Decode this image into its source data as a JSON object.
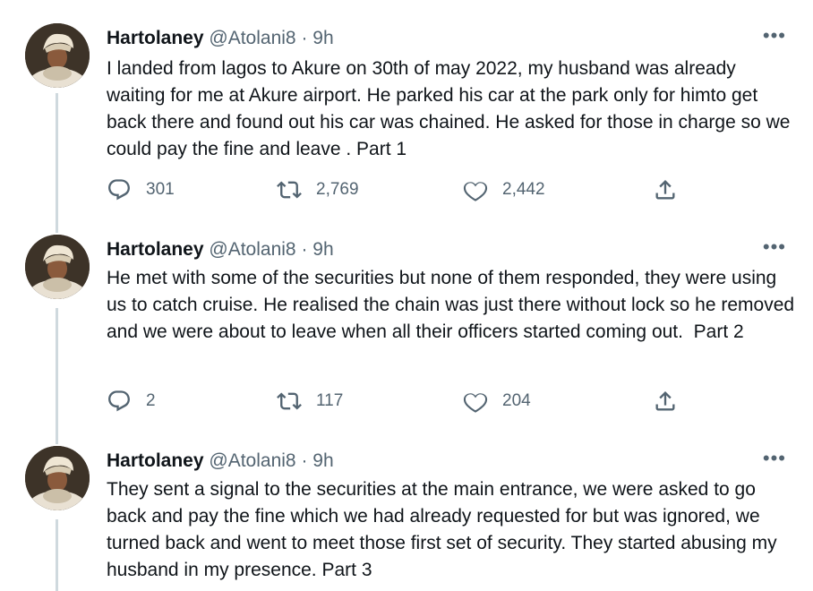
{
  "tweets": [
    {
      "name": "Hartolaney",
      "handle": "@Atolani8",
      "separator": "·",
      "time": "9h",
      "text": "I landed from lagos to Akure on 30th of may 2022, my husband was already waiting for me at Akure airport. He parked his car at the park only for himto get back there and found out his car was chained. He asked for those in charge so we could pay the fine and leave . Part 1",
      "replies": "301",
      "retweets": "2,769",
      "likes": "2,442"
    },
    {
      "name": "Hartolaney",
      "handle": "@Atolani8",
      "separator": "·",
      "time": "9h",
      "text": "He met with some of the securities but none of them responded, they were using us to catch cruise. He realised the chain was just there without lock so he removed and we were about to leave when all their officers started coming out.  Part 2",
      "replies": "2",
      "retweets": "117",
      "likes": "204"
    },
    {
      "name": "Hartolaney",
      "handle": "@Atolani8",
      "separator": "·",
      "time": "9h",
      "text": "They sent a signal to the securities at the main entrance, we were asked to go back and pay the fine which we had already requested for but was ignored, we turned back and went to meet those first set of security. They started abusing my husband in my presence. Part 3"
    }
  ],
  "more_label": "•••",
  "icons": {
    "reply": "reply-icon",
    "retweet": "retweet-icon",
    "like": "heart-icon",
    "share": "share-icon"
  },
  "colors": {
    "text": "#0f1419",
    "secondary": "#536471",
    "thread_line": "#cfd9de"
  }
}
